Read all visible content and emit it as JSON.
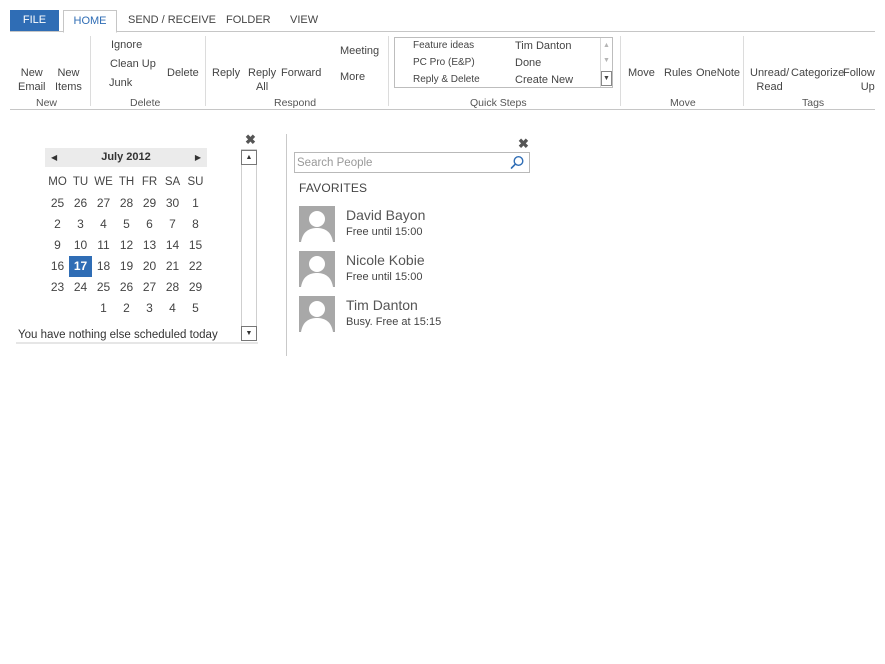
{
  "tabs": {
    "file": "FILE",
    "home": "HOME",
    "send_receive": "SEND / RECEIVE",
    "folder": "FOLDER",
    "view": "VIEW"
  },
  "ribbon": {
    "new": {
      "new_email": [
        "New",
        "Email"
      ],
      "new_items": [
        "New",
        "Items"
      ],
      "label": "New"
    },
    "delete": {
      "ignore": "Ignore",
      "clean_up": "Clean Up",
      "junk": "Junk",
      "delete": "Delete",
      "label": "Delete"
    },
    "respond": {
      "reply": "Reply",
      "reply_all": [
        "Reply",
        "All"
      ],
      "forward": "Forward",
      "meeting": "Meeting",
      "more": "More",
      "label": "Respond"
    },
    "quick_steps": {
      "items": [
        "Feature ideas",
        "Tim Danton",
        "PC Pro (E&P)",
        "Done",
        "Reply & Delete",
        "Create New"
      ],
      "label": "Quick Steps"
    },
    "move": {
      "move": "Move",
      "rules": "Rules",
      "onenote": "OneNote",
      "label": "Move"
    },
    "tags": {
      "unread_read": [
        "Unread/",
        "Read"
      ],
      "categorize": "Categorize",
      "follow_up": [
        "Follow",
        "Up"
      ],
      "label": "Tags"
    }
  },
  "calendar": {
    "month_title": "July 2012",
    "weekdays": [
      "MO",
      "TU",
      "WE",
      "TH",
      "FR",
      "SA",
      "SU"
    ],
    "weeks": [
      [
        "25",
        "26",
        "27",
        "28",
        "29",
        "30",
        "1"
      ],
      [
        "2",
        "3",
        "4",
        "5",
        "6",
        "7",
        "8"
      ],
      [
        "9",
        "10",
        "11",
        "12",
        "13",
        "14",
        "15"
      ],
      [
        "16",
        "17",
        "18",
        "19",
        "20",
        "21",
        "22"
      ],
      [
        "23",
        "24",
        "25",
        "26",
        "27",
        "28",
        "29"
      ],
      [
        "",
        "",
        "1",
        "2",
        "3",
        "4",
        "5"
      ]
    ],
    "selected_day": "17",
    "status": "You have nothing else scheduled today"
  },
  "people": {
    "search_placeholder": "Search People",
    "favorites_heading": "FAVORITES",
    "favorites": [
      {
        "name": "David Bayon",
        "status": "Free until 15:00"
      },
      {
        "name": "Nicole Kobie",
        "status": "Free until 15:00"
      },
      {
        "name": "Tim Danton",
        "status": "Busy. Free at 15:15"
      }
    ]
  },
  "colors": {
    "accent": "#2f6db5",
    "avatar": "#a8a8a8"
  }
}
